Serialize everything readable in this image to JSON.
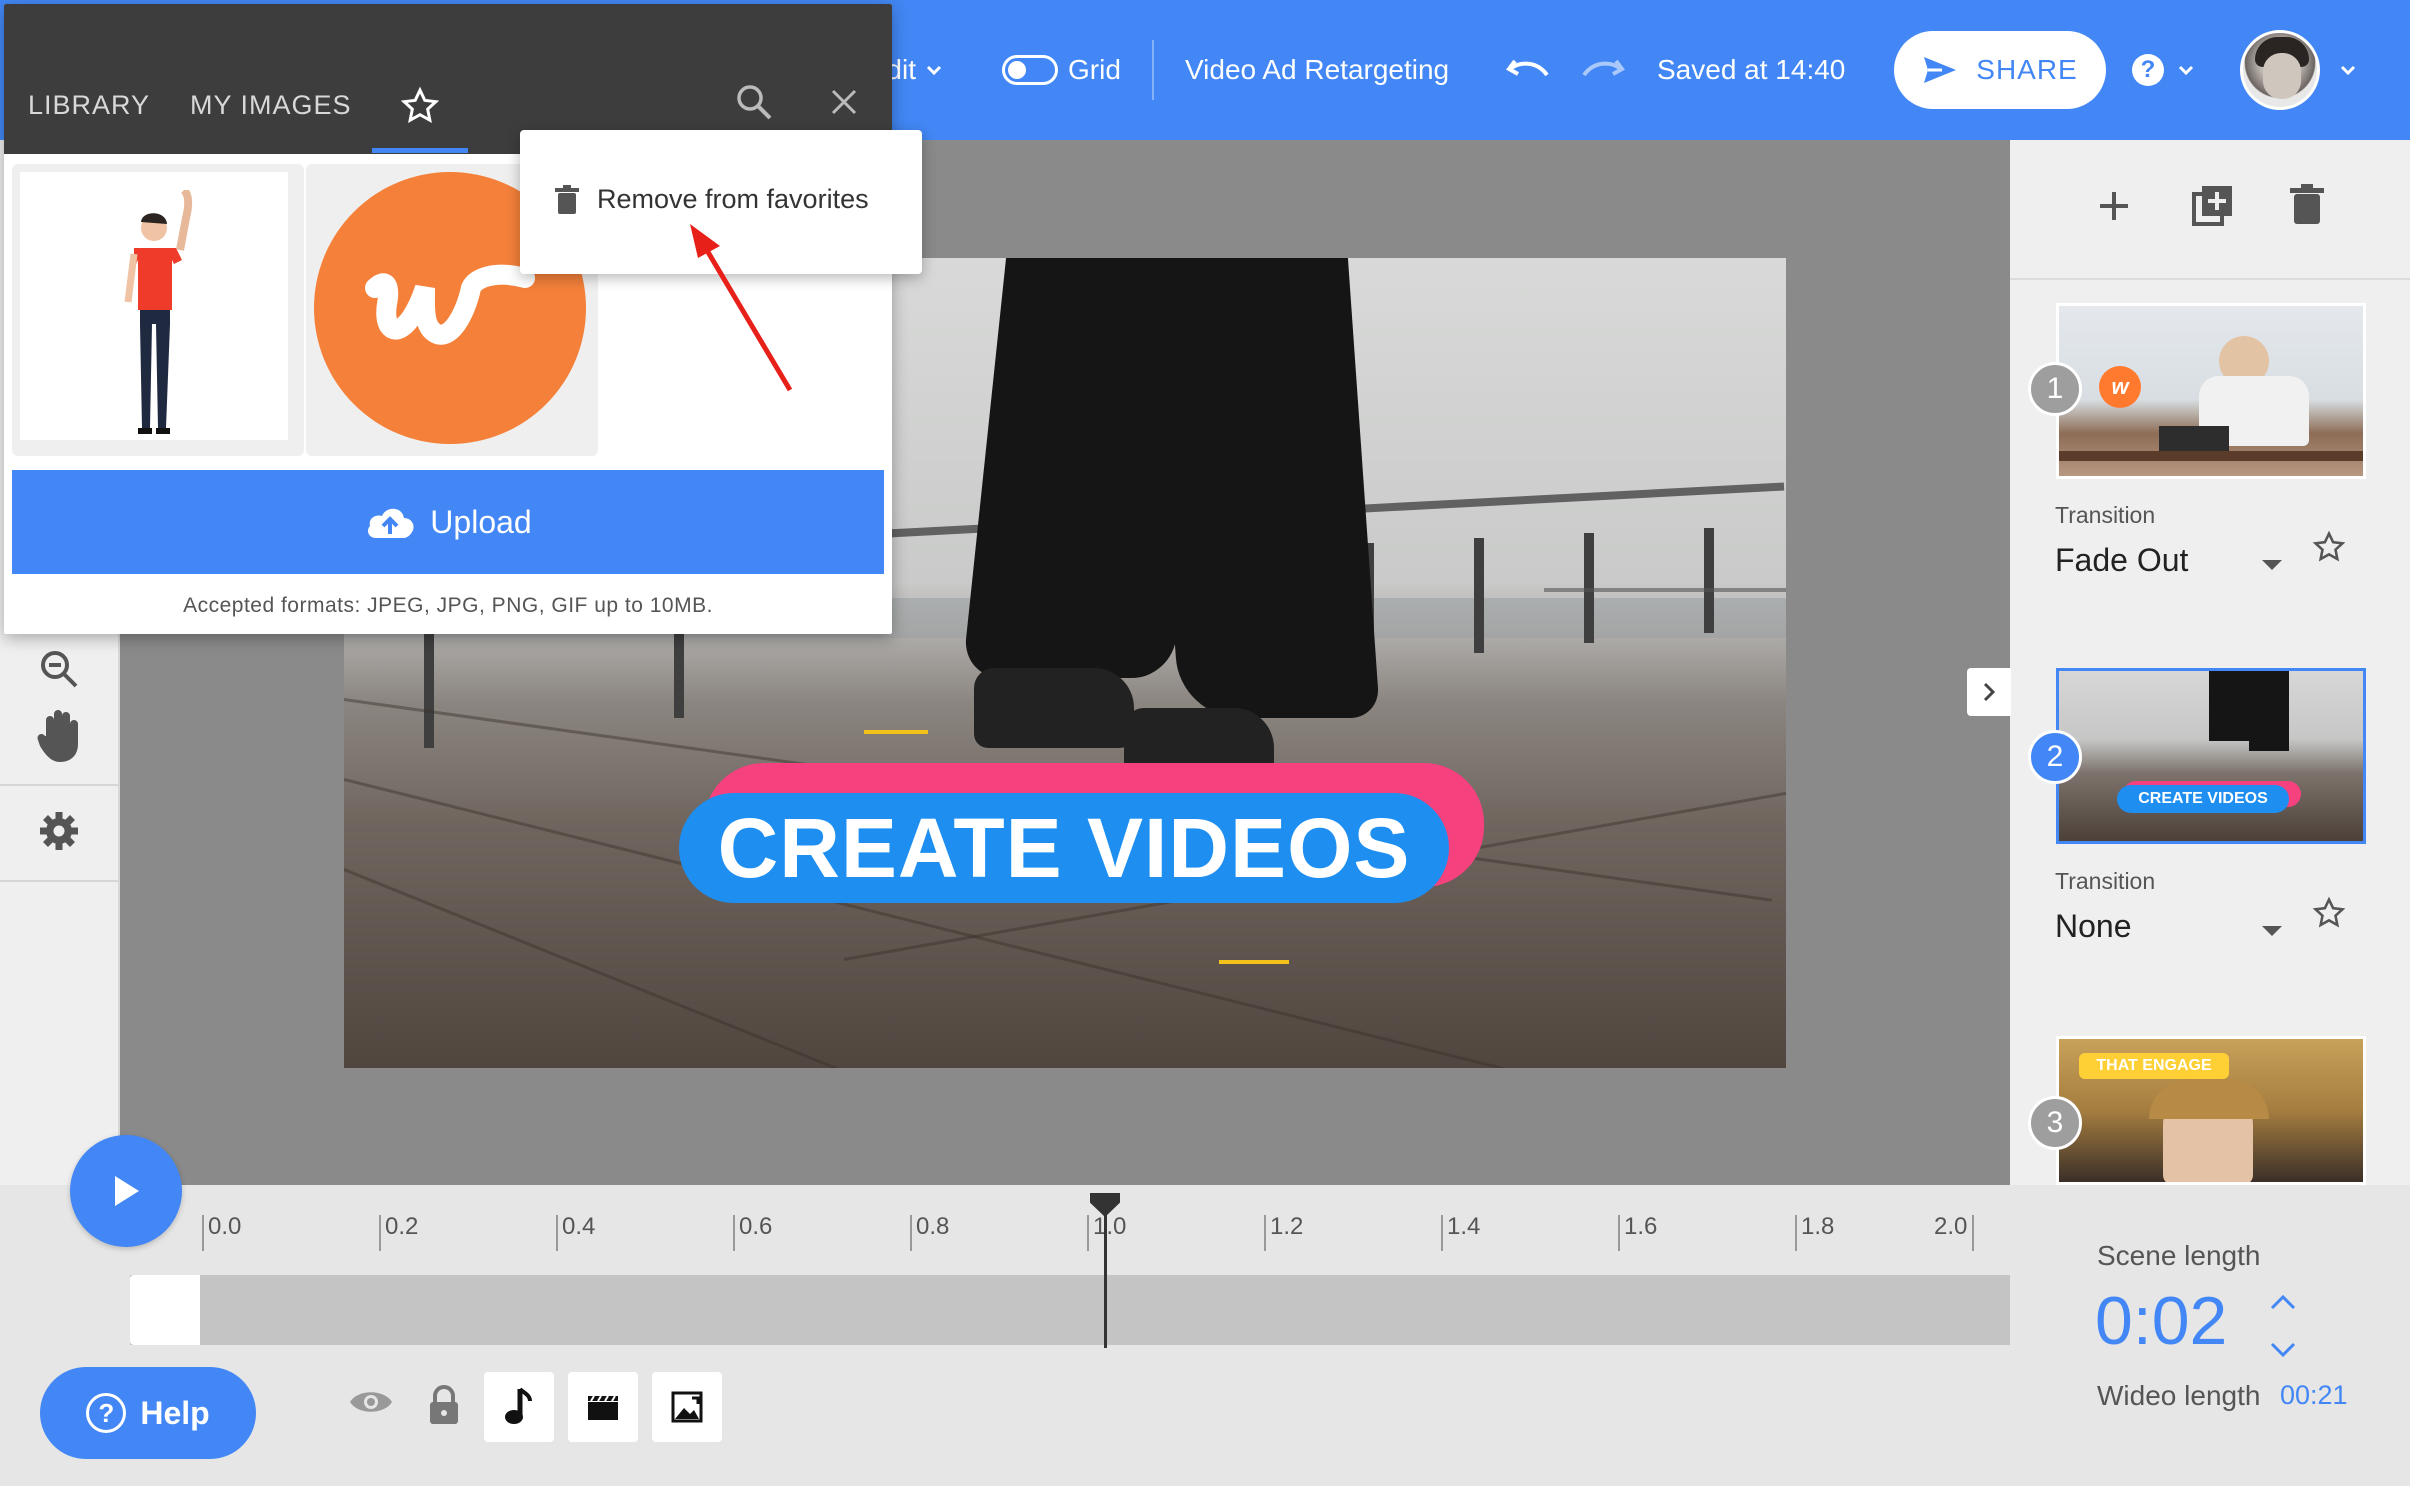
{
  "topbar": {
    "edit_menu": "Edit",
    "grid_label": "Grid",
    "project_title": "Video Ad Retargeting",
    "saved_status": "Saved at 14:40",
    "share_label": "SHARE",
    "accent_color": "#4287f5"
  },
  "popup": {
    "tabs": [
      "LIBRARY",
      "MY IMAGES"
    ],
    "active_tab_icon": "star-icon",
    "upload_label": "Upload",
    "formats_note": "Accepted formats: JPEG, JPG, PNG, GIF up to 10MB."
  },
  "context_menu": {
    "remove_label": "Remove from favorites"
  },
  "canvas": {
    "headline": "CREATE VIDEOS"
  },
  "scenes": [
    {
      "number": "1",
      "transition_label": "Transition",
      "transition": "Fade Out"
    },
    {
      "number": "2",
      "transition_label": "Transition",
      "transition": "None",
      "thumb_text": "CREATE VIDEOS"
    },
    {
      "number": "3",
      "thumb_text": "THAT ENGAGE"
    }
  ],
  "timeline": {
    "ticks": [
      "0.0",
      "0.2",
      "0.4",
      "0.6",
      "0.8",
      "1.0",
      "1.2",
      "1.4",
      "1.6",
      "1.8",
      "2.0"
    ],
    "playhead_position": "1.0",
    "help_label": "Help",
    "scene_length_label": "Scene length",
    "scene_length": "0:02",
    "video_length_label": "Wideo length",
    "video_length": "00:21"
  }
}
